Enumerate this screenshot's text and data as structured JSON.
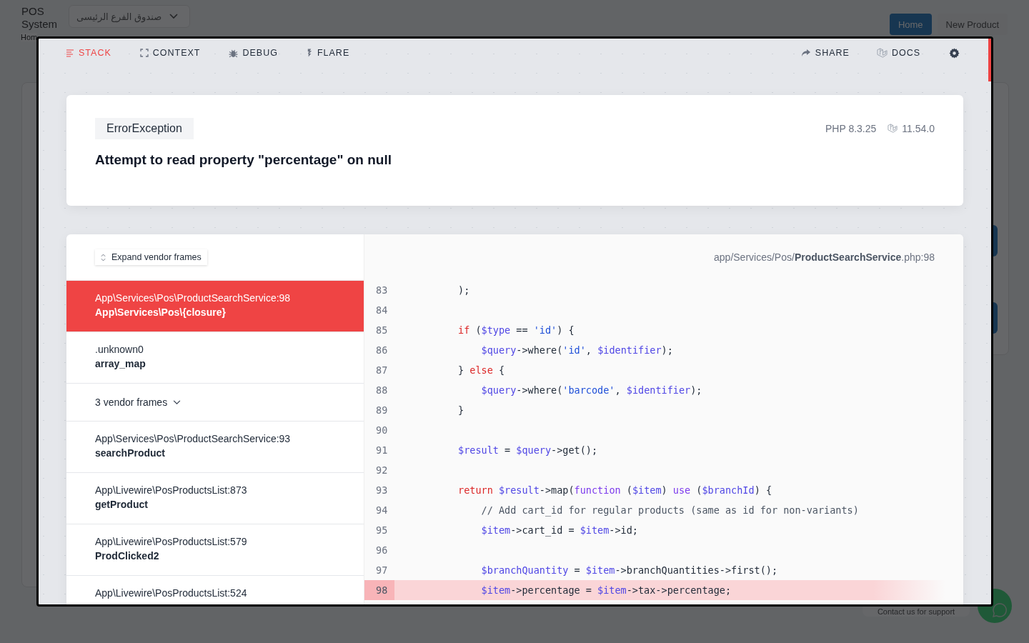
{
  "background_app": {
    "title": "POS System",
    "branch_select": {
      "value": "صندوق الفرع الرئيسى"
    },
    "breadcrumb": "Hom",
    "buttons": [
      {
        "label": "Home",
        "selected": true
      },
      {
        "label": "New Product",
        "selected": false
      }
    ],
    "support": "Contact us for support"
  },
  "error_page": {
    "tabs": [
      {
        "label": "STACK",
        "selected": true
      },
      {
        "label": "CONTEXT",
        "selected": false
      },
      {
        "label": "DEBUG",
        "selected": false
      },
      {
        "label": "FLARE",
        "selected": false
      }
    ],
    "share": {
      "label": "SHARE"
    },
    "docs": {
      "label": "DOCS"
    },
    "exception": {
      "type": "ErrorException",
      "message": "Attempt to read property \"percentage\" on null",
      "php_version": "PHP 8.3.25",
      "laravel_version": "11.54.0"
    },
    "expand_button": "Expand vendor frames",
    "frames": [
      {
        "kind": "frame",
        "file": "App\\Services\\Pos\\ProductSearchService:98",
        "method": "App\\Services\\Pos\\{closure}",
        "selected": true
      },
      {
        "kind": "frame",
        "file": ".unknown0",
        "method": "array_map",
        "selected": false
      },
      {
        "kind": "vendor_group",
        "label": "3 vendor frames",
        "selected": false
      },
      {
        "kind": "frame",
        "file": "App\\Services\\Pos\\ProductSearchService:93",
        "method": "searchProduct",
        "selected": false
      },
      {
        "kind": "frame",
        "file": "App\\Livewire\\PosProductsList:873",
        "method": "getProduct",
        "selected": false
      },
      {
        "kind": "frame",
        "file": "App\\Livewire\\PosProductsList:579",
        "method": "ProdClicked2",
        "selected": false
      },
      {
        "kind": "frame",
        "file": "App\\Livewire\\PosProductsList:524",
        "selected": false
      }
    ],
    "file_path": "app/Services/Pos/**ProductSearchService**.php:98",
    "code_lines": [
      {
        "number": "83",
        "highlighted": false,
        "tokens": [
          {
            "kind": "plain",
            "text": "        );"
          }
        ]
      },
      {
        "number": "84",
        "highlighted": false
      },
      {
        "number": "85",
        "highlighted": false,
        "tokens": [
          {
            "kind": "keyword",
            "text": "        if"
          },
          {
            "kind": "plain",
            "text": " ("
          },
          {
            "kind": "variable",
            "text": "$type"
          },
          {
            "kind": "plain",
            "text": " == "
          },
          {
            "kind": "string",
            "text": "'id'"
          },
          {
            "kind": "plain",
            "text": ") {"
          }
        ]
      },
      {
        "number": "86",
        "highlighted": false,
        "tokens": [
          {
            "kind": "variable",
            "text": "            $query"
          },
          {
            "kind": "plain",
            "text": "->where("
          },
          {
            "kind": "string",
            "text": "'id'"
          },
          {
            "kind": "plain",
            "text": ", "
          },
          {
            "kind": "variable",
            "text": "$identifier"
          },
          {
            "kind": "plain",
            "text": ");"
          }
        ]
      },
      {
        "number": "87",
        "highlighted": false,
        "tokens": [
          {
            "kind": "plain",
            "text": "        } "
          },
          {
            "kind": "keyword",
            "text": "else"
          },
          {
            "kind": "plain",
            "text": " {"
          }
        ]
      },
      {
        "number": "88",
        "highlighted": false,
        "tokens": [
          {
            "kind": "variable",
            "text": "            $query"
          },
          {
            "kind": "plain",
            "text": "->where("
          },
          {
            "kind": "string",
            "text": "'barcode'"
          },
          {
            "kind": "plain",
            "text": ", "
          },
          {
            "kind": "variable",
            "text": "$identifier"
          },
          {
            "kind": "plain",
            "text": ");"
          }
        ]
      },
      {
        "number": "89",
        "highlighted": false,
        "tokens": [
          {
            "kind": "plain",
            "text": "        }"
          }
        ]
      },
      {
        "number": "90",
        "highlighted": false
      },
      {
        "number": "91",
        "highlighted": false,
        "tokens": [
          {
            "kind": "variable",
            "text": "        $result"
          },
          {
            "kind": "plain",
            "text": " = "
          },
          {
            "kind": "variable",
            "text": "$query"
          },
          {
            "kind": "plain",
            "text": "->get();"
          }
        ]
      },
      {
        "number": "92",
        "highlighted": false
      },
      {
        "number": "93",
        "highlighted": false,
        "tokens": [
          {
            "kind": "keyword",
            "text": "        return "
          },
          {
            "kind": "variable",
            "text": "$result"
          },
          {
            "kind": "plain",
            "text": "->map("
          },
          {
            "kind": "function",
            "text": "function"
          },
          {
            "kind": "plain",
            "text": " ("
          },
          {
            "kind": "variable",
            "text": "$item"
          },
          {
            "kind": "plain",
            "text": ") "
          },
          {
            "kind": "function",
            "text": "use"
          },
          {
            "kind": "plain",
            "text": " ("
          },
          {
            "kind": "variable",
            "text": "$branchId"
          },
          {
            "kind": "plain",
            "text": ") {"
          }
        ]
      },
      {
        "number": "94",
        "highlighted": false,
        "tokens": [
          {
            "kind": "comment",
            "text": "            // Add cart_id for regular products (same as id for non-variants)"
          }
        ]
      },
      {
        "number": "95",
        "highlighted": false,
        "tokens": [
          {
            "kind": "variable",
            "text": "            $item"
          },
          {
            "kind": "plain",
            "text": "->cart_id = "
          },
          {
            "kind": "variable",
            "text": "$item"
          },
          {
            "kind": "plain",
            "text": "->id;"
          }
        ]
      },
      {
        "number": "96",
        "highlighted": false
      },
      {
        "number": "97",
        "highlighted": false,
        "tokens": [
          {
            "kind": "variable",
            "text": "            $branchQuantity"
          },
          {
            "kind": "plain",
            "text": " = "
          },
          {
            "kind": "variable",
            "text": "$item"
          },
          {
            "kind": "plain",
            "text": "->branchQuantities->first();"
          }
        ]
      },
      {
        "number": "98",
        "highlighted": true,
        "tokens": [
          {
            "kind": "variable",
            "text": "            $item"
          },
          {
            "kind": "plain",
            "text": "->percentage = "
          },
          {
            "kind": "variable",
            "text": "$item"
          },
          {
            "kind": "plain",
            "text": "->tax->percentage;"
          }
        ]
      }
    ]
  }
}
